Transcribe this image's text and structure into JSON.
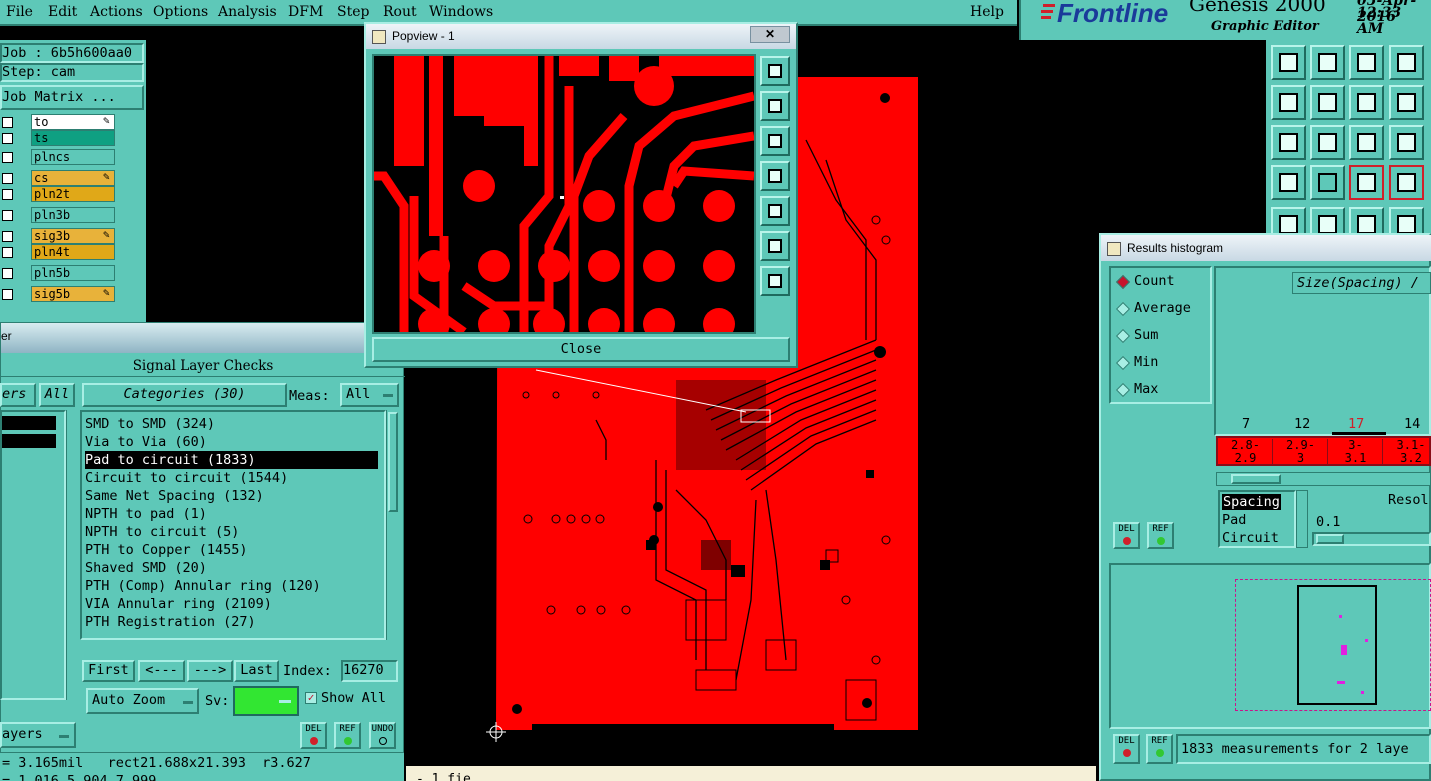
{
  "menu": {
    "items": [
      "File",
      "Edit",
      "Actions",
      "Options",
      "Analysis",
      "DFM",
      "Step",
      "Rout",
      "Windows"
    ],
    "help": "Help"
  },
  "brand": {
    "name": "Frontline",
    "product": "Genesis 2000",
    "subtitle": "Graphic Editor",
    "date": "05-Apr-2016",
    "time": "12:33 AM"
  },
  "job": {
    "job_label": "Job : 6b5h600aa0",
    "step_label": "Step: cam",
    "matrix_button": "Job Matrix ..."
  },
  "layers": [
    {
      "name": "to",
      "color": "#ffffff",
      "edit": true
    },
    {
      "name": "ts",
      "color": "#0fa082",
      "edit": false
    },
    {
      "name": "plncs",
      "color": "#5ec8b8",
      "edit": false
    },
    {
      "name": "cs",
      "color": "#e8b23a",
      "edit": true
    },
    {
      "name": "pln2t",
      "color": "#e0a818",
      "edit": false
    },
    {
      "name": "pln3b",
      "color": "#5ec8b8",
      "edit": false
    },
    {
      "name": "sig3b",
      "color": "#e8b23a",
      "edit": true
    },
    {
      "name": "pln4t",
      "color": "#e0a818",
      "edit": false
    },
    {
      "name": "pln5b",
      "color": "#5ec8b8",
      "edit": false
    },
    {
      "name": "sig5b",
      "color": "#e8b23a",
      "edit": true
    }
  ],
  "popview": {
    "title": "Popview - 1",
    "close_label": "Close"
  },
  "checks": {
    "title": "Signal Layer Checks",
    "left_header": "ers",
    "all_tab": "All",
    "categories_header": "Categories (30)",
    "meas_label": "Meas:",
    "meas_value": "All",
    "categories": [
      "SMD to SMD (324)",
      "Via to Via (60)",
      "Pad to circuit (1833)",
      "Circuit to circuit (1544)",
      "Same Net Spacing (132)",
      "NPTH to pad (1)",
      "NPTH to circuit (5)",
      "PTH to Copper (1455)",
      "Shaved SMD (20)",
      "PTH (Comp) Annular ring (120)",
      "VIA Annular ring (2109)",
      "PTH Registration (27)"
    ],
    "selected_index": 2,
    "first_label": "First",
    "prev_label": "<---",
    "next_label": "--->",
    "last_label": "Last",
    "index_label": "Index:",
    "index_value": "16270",
    "autozoom_label": "Auto Zoom",
    "sv_label": "Sv:",
    "show_all_label": "Show All",
    "layers_menu_label": "ayers",
    "del_label": "DEL",
    "ref_label": "REF",
    "undo_label": "UNDO"
  },
  "status": {
    "line1": "= 3.165mil   rect21.688x21.393  r3.627",
    "line2": "= 1.016 5.904 7.999"
  },
  "histogram": {
    "title": "Results histogram",
    "modes": [
      "Count",
      "Average",
      "Sum",
      "Min",
      "Max"
    ],
    "selected_mode": "Count",
    "measure_header": "Size(Spacing) /",
    "counts": [
      "7",
      "12",
      "17",
      "14"
    ],
    "highlight_count": "17",
    "bins": [
      "2.8-\n2.9",
      "2.9-\n3",
      "3-\n3.1",
      "3.1-\n3.2"
    ],
    "types": [
      "Spacing",
      "Pad",
      "Circuit"
    ],
    "selected_type": "Spacing",
    "resolution_label": "Resol",
    "resolution_value": "0.1",
    "del_label": "DEL",
    "ref_label": "REF",
    "summary": "1833 measurements for 2 laye"
  },
  "colors": {
    "ui": "#5ec8b8",
    "board": "#ff0000",
    "background": "#000000",
    "highlight": "#c8142c",
    "sv_indicator": "#32e632"
  },
  "bottom_text": "- 1 fie"
}
